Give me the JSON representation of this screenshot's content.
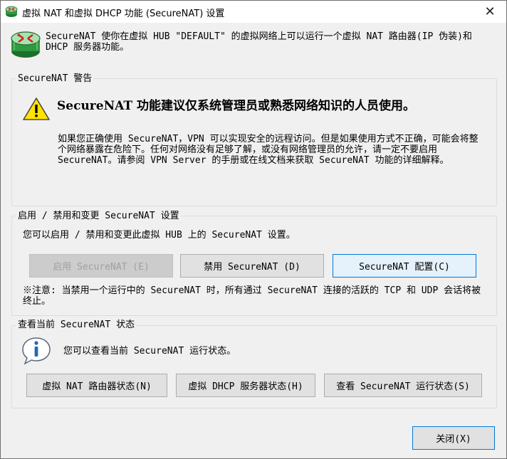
{
  "window": {
    "title": "虚拟 NAT 和虚拟 DHCP 功能 (SecureNAT) 设置",
    "close_glyph": "✕"
  },
  "intro": {
    "text": "SecureNAT 使你在虚拟 HUB \"DEFAULT\" 的虚拟网络上可以运行一个虚拟 NAT 路由器(IP 伪装)和 DHCP 服务器功能。"
  },
  "warning_group": {
    "label": "SecureNAT 警告",
    "headline": "SecureNAT 功能建议仅系统管理员或熟悉网络知识的人员使用。",
    "body": "如果您正确使用 SecureNAT，VPN 可以实现安全的远程访问。但是如果使用方式不正确，可能会将整个网络暴露在危险下。任何对网络没有足够了解，或没有网络管理员的允许，请一定不要启用 SecureNAT。请参阅 VPN Server 的手册或在线文档来获取 SecureNAT 功能的详细解释。"
  },
  "control_group": {
    "label": "启用 / 禁用和变更 SecureNAT 设置",
    "description": "您可以启用 / 禁用和变更此虚拟 HUB 上的 SecureNAT 设置。",
    "enable_button": "启用 SecureNAT (E)",
    "disable_button": "禁用 SecureNAT (D)",
    "config_button": "SecureNAT 配置(C)",
    "note": "※注意: 当禁用一个运行中的 SecureNAT 时，所有通过 SecureNAT 连接的活跃的 TCP 和 UDP 会话将被终止。"
  },
  "status_group": {
    "label": "查看当前 SecureNAT 状态",
    "description": "您可以查看当前 SecureNAT 运行状态。",
    "nat_status_button": "虚拟 NAT 路由器状态(N)",
    "dhcp_status_button": "虚拟 DHCP 服务器状态(H)",
    "run_status_button": "查看 SecureNAT 运行状态(S)"
  },
  "footer": {
    "close_button": "关闭(X)"
  },
  "colors": {
    "background": "#f0f0f0",
    "focus_accent": "#0078d7",
    "warning_yellow": "#ffe400",
    "router_green": "#2f9a41",
    "router_red": "#d81e1e",
    "info_blue": "#2767b8"
  },
  "icons": {
    "title": "router-icon",
    "header": "router-icon",
    "warning": "warning-icon",
    "status": "info-icon"
  }
}
